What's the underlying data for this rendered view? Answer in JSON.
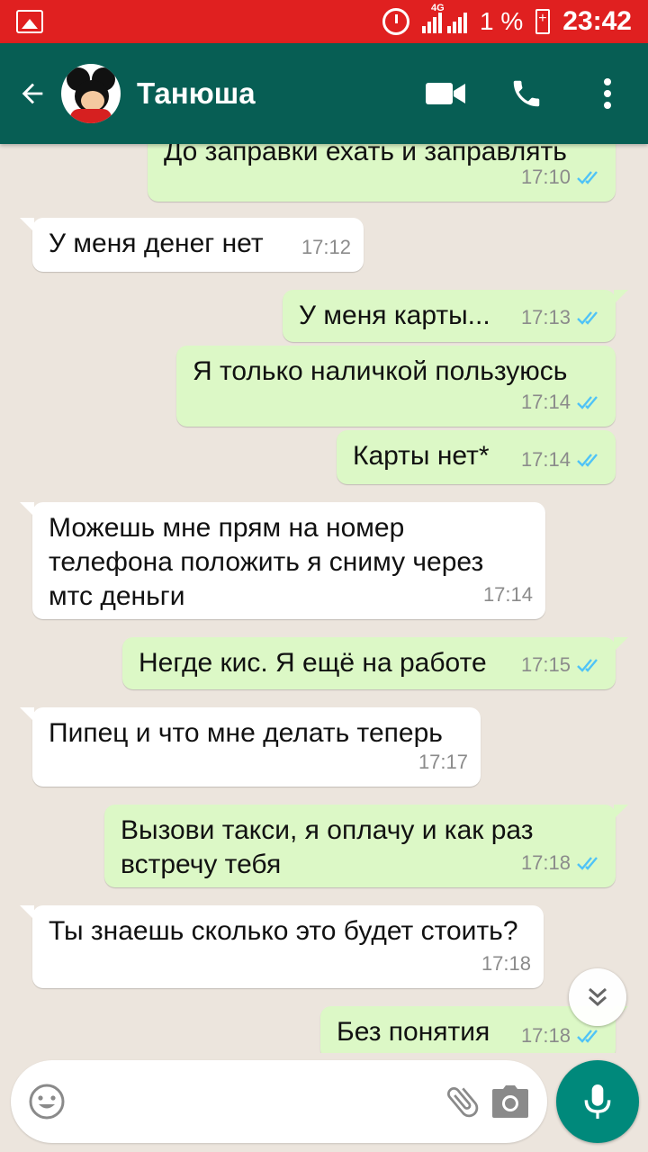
{
  "status_bar": {
    "network": "4G",
    "battery": "1 %",
    "time": "23:42"
  },
  "header": {
    "contact_name": "Танюша"
  },
  "icons": {
    "back": "arrow-back-icon",
    "video": "video-call-icon",
    "call": "phone-icon",
    "menu": "more-vert-icon",
    "emoji": "emoji-icon",
    "attach": "paperclip-icon",
    "camera": "camera-icon",
    "mic": "mic-icon",
    "scroll": "chevron-double-down-icon"
  },
  "colors": {
    "header": "#075e54",
    "status_bar": "#e02020",
    "outgoing": "#dcf8c6",
    "incoming": "#ffffff",
    "read_ticks": "#4fc3f7",
    "mic": "#00897b"
  },
  "messages": [
    {
      "dir": "out",
      "text": "До заправки ехать и заправлять",
      "time": "17:10",
      "read": true
    },
    {
      "dir": "in",
      "text": "У меня денег нет",
      "time": "17:12"
    },
    {
      "dir": "out",
      "text": "У меня карты...",
      "time": "17:13",
      "read": true
    },
    {
      "dir": "out",
      "text": "Я только наличкой пользуюсь",
      "time": "17:14",
      "read": true
    },
    {
      "dir": "out",
      "text": "Карты нет*",
      "time": "17:14",
      "read": true
    },
    {
      "dir": "in",
      "text": "Можешь мне прям на номер телефона положить я сниму через мтс деньги",
      "time": "17:14"
    },
    {
      "dir": "out",
      "text": "Негде кис. Я ещё на работе",
      "time": "17:15",
      "read": true
    },
    {
      "dir": "in",
      "text": "Пипец и что мне делать теперь",
      "time": "17:17"
    },
    {
      "dir": "out",
      "text": "Вызови такси, я оплачу и как раз встречу тебя",
      "time": "17:18",
      "read": true
    },
    {
      "dir": "in",
      "text": "Ты знаешь сколько это будет стоить?",
      "time": "17:18"
    },
    {
      "dir": "out",
      "text": "Без понятия",
      "time": "17:18",
      "read": true
    }
  ],
  "composer": {
    "placeholder": ""
  }
}
